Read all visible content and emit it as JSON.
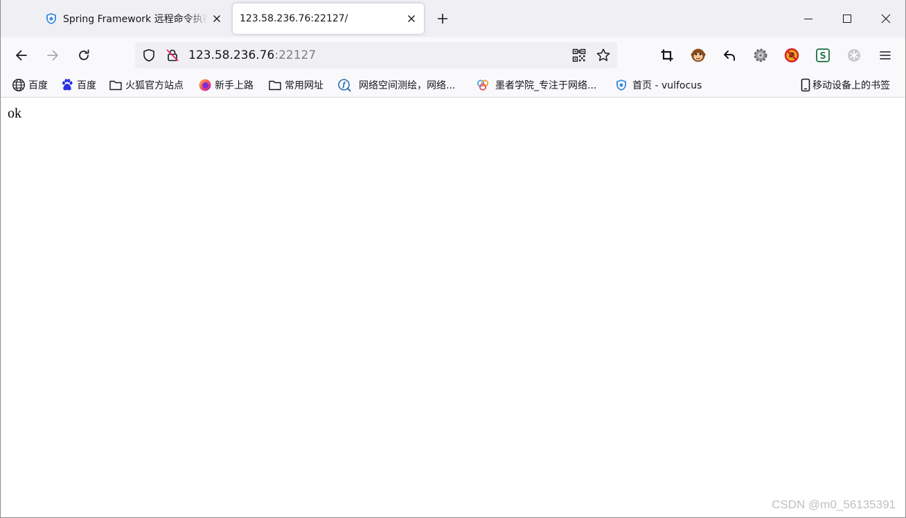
{
  "tabs": [
    {
      "title": "Spring Framework 远程命令执行",
      "active": false,
      "favicon": "vulfocus-shield-icon"
    },
    {
      "title": "123.58.236.76:22127/",
      "active": true
    }
  ],
  "urlbar": {
    "host": "123.58.236.76",
    "port": ":22127"
  },
  "toolbar_icons": [
    "crop-icon",
    "monkey-extension-icon",
    "undo-arrow-icon",
    "gear-extension-icon",
    "blocked-extension-icon",
    "s-extension-icon",
    "snowflake-extension-icon",
    "hamburger-menu-icon"
  ],
  "bookmarks": [
    {
      "label": "百度",
      "icon": "globe-icon"
    },
    {
      "label": "百度",
      "icon": "baidu-paw-icon"
    },
    {
      "label": "火狐官方站点",
      "icon": "folder-icon"
    },
    {
      "label": "新手上路",
      "icon": "firefox-icon"
    },
    {
      "label": "常用网址",
      "icon": "folder-icon"
    },
    {
      "label": "网络空间测绘，网络...",
      "icon": "fofa-icon"
    },
    {
      "label": "墨者学院_专注于网络...",
      "icon": "mozhe-icon"
    },
    {
      "label": "首页 - vulfocus",
      "icon": "vulfocus-shield-icon"
    }
  ],
  "mobile_bookmarks": {
    "label": "移动设备上的书签",
    "icon": "mobile-device-icon"
  },
  "page": {
    "body_text": "ok"
  },
  "watermark": "CSDN @m0_56135391",
  "colors": {
    "tabstrip_bg": "#f0f0f4",
    "toolbar_bg": "#f9f9fb",
    "urlbar_bg": "#f0f0f4",
    "text": "#15141a",
    "url_port": "#7b7b83",
    "vulfocus_blue": "#3d8fe0"
  }
}
